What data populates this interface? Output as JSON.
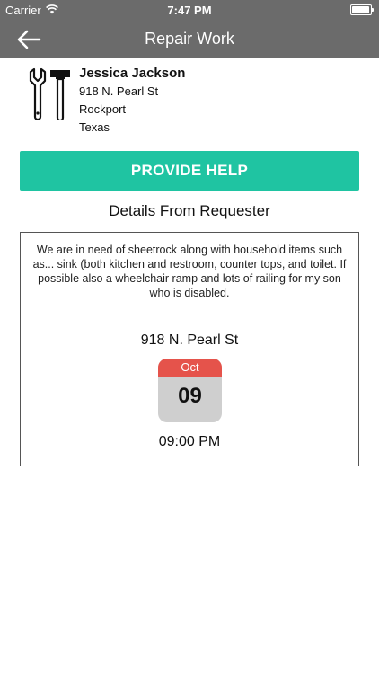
{
  "status_bar": {
    "carrier": "Carrier",
    "time": "7:47 PM"
  },
  "nav": {
    "title": "Repair Work"
  },
  "requester": {
    "name": "Jessica Jackson",
    "street": "918 N. Pearl St",
    "city": "Rockport",
    "state": "Texas"
  },
  "actions": {
    "provide_help_label": "PROVIDE HELP"
  },
  "details": {
    "heading": "Details From Requester",
    "description": "We are in need of sheetrock along with household items such as...  sink (both kitchen and restroom, counter tops, and toilet. If possible also a wheelchair ramp and lots of railing for my son who is disabled.",
    "location": "918 N. Pearl St",
    "date_month": "Oct",
    "date_day": "09",
    "time": "09:00 PM"
  },
  "colors": {
    "nav_bg": "#6b6b6b",
    "accent": "#1fc4a2",
    "calendar_header": "#e5534b"
  },
  "icons": {
    "back": "back-arrow-icon",
    "tools": "tools-icon",
    "wifi": "wifi-icon",
    "battery": "battery-icon"
  }
}
